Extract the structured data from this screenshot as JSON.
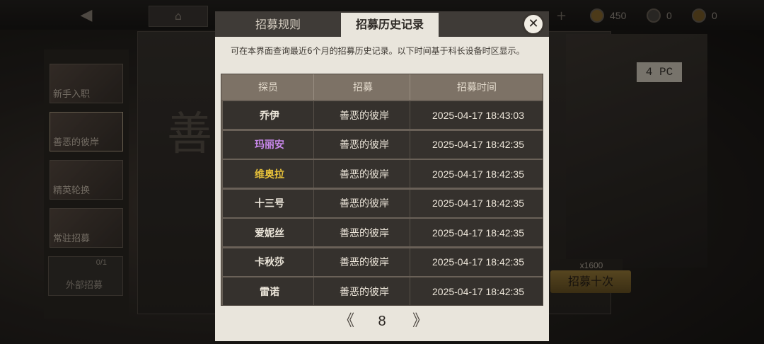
{
  "background": {
    "back_icon": "back-arrow-icon",
    "home_icon": "home-icon",
    "currencies": [
      {
        "icon": "gold-coin-icon",
        "value": "450"
      },
      {
        "icon": "gear-token-icon",
        "value": "0"
      },
      {
        "icon": "medal-token-icon",
        "value": "0"
      }
    ],
    "side_tabs": [
      "新手入职",
      "善恶的彼岸",
      "精英轮换",
      "常驻招募"
    ],
    "outside_recruit": {
      "label": "外部招募",
      "count": "0/1"
    },
    "deco_tag": "4 PC",
    "cost": "x1600",
    "recruit_ten": "招募十次"
  },
  "modal": {
    "tabs": {
      "rules": "招募规则",
      "history": "招募历史记录"
    },
    "active_tab": "history",
    "description": "可在本界面查询最近6个月的招募历史记录。以下时间基于科长设备时区显示。",
    "table": {
      "headers": {
        "agent": "探员",
        "recruit": "招募",
        "time": "招募时间"
      },
      "rows": [
        {
          "agent": "乔伊",
          "recruit": "善恶的彼岸",
          "time": "2025-04-17 18:43:03",
          "color": "#ece6da"
        },
        {
          "agent": "玛丽安",
          "recruit": "善恶的彼岸",
          "time": "2025-04-17 18:42:35",
          "color": "#c888ea"
        },
        {
          "agent": "维奥拉",
          "recruit": "善恶的彼岸",
          "time": "2025-04-17 18:42:35",
          "color": "#e8c23a"
        },
        {
          "agent": "十三号",
          "recruit": "善恶的彼岸",
          "time": "2025-04-17 18:42:35",
          "color": "#ece6da"
        },
        {
          "agent": "爱妮丝",
          "recruit": "善恶的彼岸",
          "time": "2025-04-17 18:42:35",
          "color": "#ece6da"
        },
        {
          "agent": "卡秋莎",
          "recruit": "善恶的彼岸",
          "time": "2025-04-17 18:42:35",
          "color": "#ece6da"
        },
        {
          "agent": "雷诺",
          "recruit": "善恶的彼岸",
          "time": "2025-04-17 18:42:35",
          "color": "#ece6da"
        }
      ]
    },
    "pager": {
      "prev": "《",
      "page": "8",
      "next": "》"
    }
  }
}
